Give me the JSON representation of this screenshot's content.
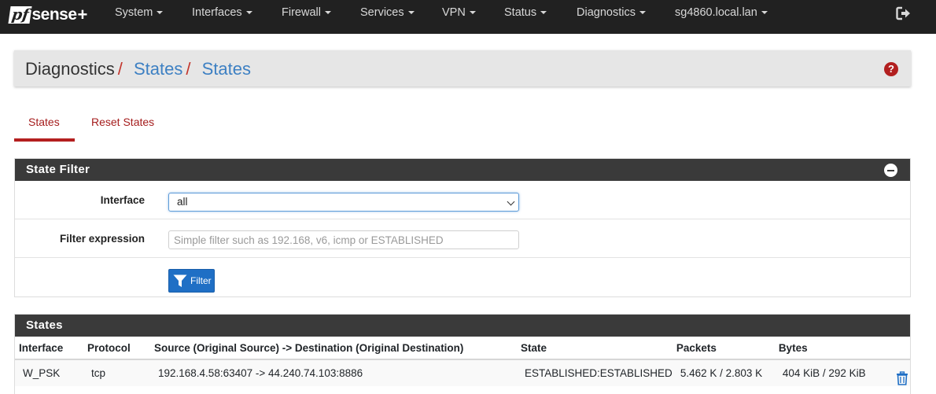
{
  "brand": {
    "logo_box": "pf",
    "logo_text": "sense",
    "logo_plus": "+"
  },
  "nav": {
    "items": [
      {
        "label": "System"
      },
      {
        "label": "Interfaces"
      },
      {
        "label": "Firewall"
      },
      {
        "label": "Services"
      },
      {
        "label": "VPN"
      },
      {
        "label": "Status"
      },
      {
        "label": "Diagnostics"
      },
      {
        "label": "sg4860.local.lan"
      }
    ],
    "logout_icon": "sign-out-icon"
  },
  "breadcrumb": {
    "items": [
      "Diagnostics",
      "States",
      "States"
    ],
    "separator": "/"
  },
  "help_icon_label": "?",
  "tabs": [
    {
      "label": "States",
      "active": true
    },
    {
      "label": "Reset States",
      "active": false
    }
  ],
  "state_filter": {
    "title": "State Filter",
    "interface_label": "Interface",
    "interface_value": "all",
    "filter_expression_label": "Filter expression",
    "filter_expression_value": "",
    "filter_expression_placeholder": "Simple filter such as 192.168, v6, icmp or ESTABLISHED",
    "filter_button_label": "Filter"
  },
  "states": {
    "title": "States",
    "columns": [
      "Interface",
      "Protocol",
      "Source (Original Source) -> Destination (Original Destination)",
      "State",
      "Packets",
      "Bytes"
    ],
    "rows": [
      {
        "interface": "W_PSK",
        "protocol": "tcp",
        "source_dest": "192.168.4.58:63407 -> 44.240.74.103:8886",
        "state": "ESTABLISHED:ESTABLISHED",
        "packets": "5.462 K / 2.803 K",
        "bytes": "404 KiB / 292 KiB"
      }
    ]
  },
  "colors": {
    "navbar_bg": "#212121",
    "accent_red": "#b41f1f",
    "link_blue": "#3d80c3",
    "panel_head_bg": "#3a3a3a",
    "button_blue": "#1f6fc5"
  }
}
